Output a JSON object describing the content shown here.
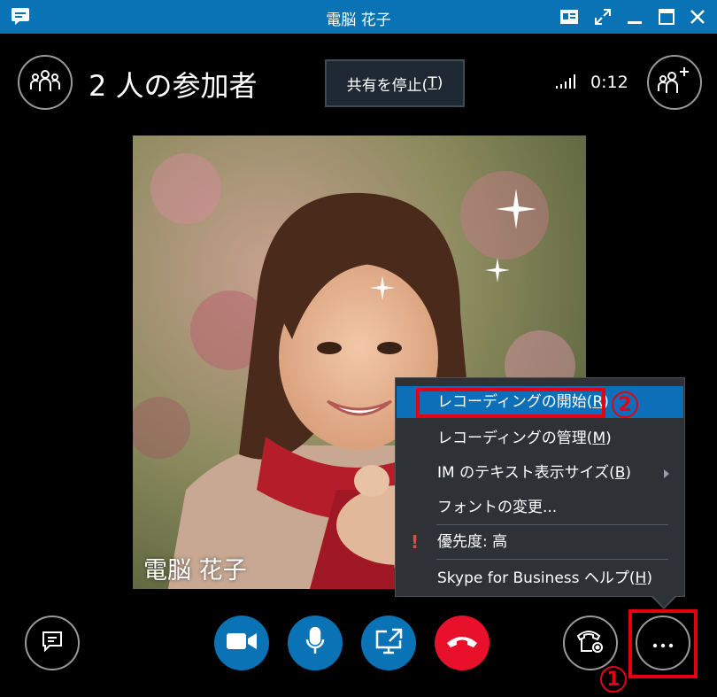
{
  "window": {
    "title": "電脳 花子"
  },
  "header": {
    "participants_text": "2 人の参加者",
    "stop_share_label": "共有を停止(T)",
    "stop_share_prefix": "共有を停止(",
    "stop_share_key": "T",
    "stop_share_suffix": ")",
    "timer": "0:12"
  },
  "video": {
    "caller_name": "電脳 花子"
  },
  "menu": {
    "items": [
      {
        "prefix": "レコーディングの開始(",
        "key": "R",
        "suffix": ")"
      },
      {
        "prefix": "レコーディングの管理(",
        "key": "M",
        "suffix": ")"
      },
      {
        "prefix": "IM のテキスト表示サイズ(",
        "key": "B",
        "suffix": ")"
      },
      {
        "prefix": "フォントの変更...",
        "key": "",
        "suffix": ""
      },
      {
        "prefix": "優先度: 高",
        "key": "",
        "suffix": ""
      },
      {
        "prefix": "Skype for Business ヘルプ(",
        "key": "H",
        "suffix": ")"
      }
    ],
    "warning_mark": "!"
  },
  "annotations": {
    "step1": "1",
    "step2": "2"
  },
  "colors": {
    "titlebar": "#0a73b5",
    "accent": "#0a73b5",
    "hangup": "#e8102a",
    "annotation": "#e60012",
    "menu_bg": "#2e3136",
    "selected": "#0d6fb8"
  },
  "icons": [
    "chat-app-icon",
    "presenter-view-icon",
    "expand-icon",
    "minimize-icon",
    "maximize-icon",
    "close-icon",
    "participants-icon",
    "signal-bars-icon",
    "add-participant-icon",
    "im-icon",
    "video-camera-icon",
    "microphone-icon",
    "present-screen-icon",
    "hang-up-icon",
    "call-controls-icon",
    "more-options-icon",
    "submenu-arrow-icon"
  ]
}
